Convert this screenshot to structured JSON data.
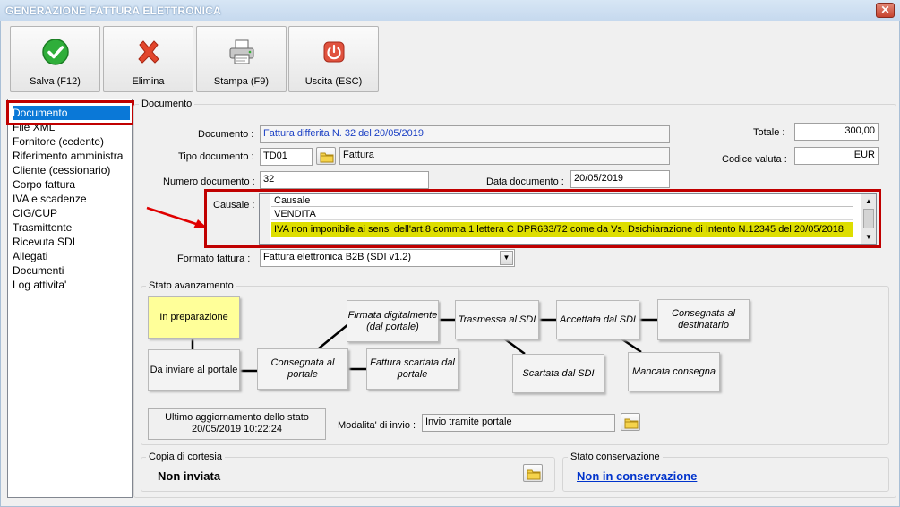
{
  "window": {
    "title": "GENERAZIONE FATTURA ELETTRONICA",
    "close": "✕"
  },
  "toolbar": {
    "save": "Salva (F12)",
    "delete": "Elimina",
    "print": "Stampa (F9)",
    "exit": "Uscita (ESC)"
  },
  "sidebar": {
    "items": [
      "Documento",
      "File XML",
      "Fornitore (cedente)",
      "Riferimento amministra",
      "Cliente (cessionario)",
      "Corpo fattura",
      "IVA e scadenze",
      "CIG/CUP",
      "Trasmittente",
      "Ricevuta SDI",
      "Allegati",
      "Documenti",
      "Log attivita'"
    ],
    "selected": 0
  },
  "documento": {
    "group_title": "Documento",
    "documento_label": "Documento :",
    "documento_value": "Fattura differita N. 32 del 20/05/2019",
    "tipo_label": "Tipo documento :",
    "tipo_code": "TD01",
    "tipo_desc": "Fattura",
    "numero_label": "Numero documento :",
    "numero_value": "32",
    "data_label": "Data documento :",
    "data_value": "20/05/2019",
    "totale_label": "Totale :",
    "totale_value": "300,00",
    "valuta_label": "Codice valuta :",
    "valuta_value": "EUR",
    "causale_label": "Causale :",
    "causale_header": "Causale",
    "causale_rows": [
      "VENDITA",
      "IVA non imponibile ai sensi dell'art.8 comma 1 lettera C DPR633/72 come da Vs. Dsichiarazione di Intento N.12345 del 20/05/2018",
      ""
    ],
    "formato_label": "Formato fattura :",
    "formato_value": "Fattura elettronica B2B (SDI v1.2)"
  },
  "stato": {
    "group_title": "Stato avanzamento",
    "in_preparazione": "In preparazione",
    "da_inviare": "Da inviare al portale",
    "consegnata_portale": "Consegnata al portale",
    "firmata": "Firmata digitalmente (dal portale)",
    "scartata_portale": "Fattura scartata dal portale",
    "trasmessa": "Trasmessa al SDI",
    "scartata_sdi": "Scartata dal SDI",
    "accettata": "Accettata dal SDI",
    "mancata": "Mancata consegna",
    "consegnata_dest": "Consegnata al destinatario",
    "ultimo_label": "Ultimo aggiornamento dello stato",
    "ultimo_value": "20/05/2019 10:22:24",
    "modalita_label": "Modalita' di invio :",
    "modalita_value": "Invio tramite portale"
  },
  "copia": {
    "group_title": "Copia di cortesia",
    "value": "Non inviata"
  },
  "conservazione": {
    "group_title": "Stato conservazione",
    "value": "Non in conservazione"
  },
  "colors": {
    "selection": "#0a78d7",
    "highlight": "#c00000",
    "row_highlight": "#dede00",
    "link": "#0033cc",
    "state_current": "#ffff99"
  }
}
